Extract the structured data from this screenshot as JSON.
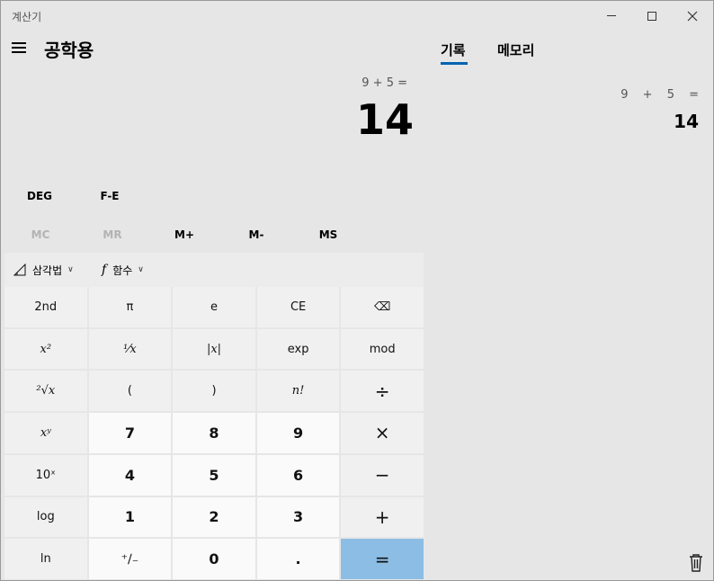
{
  "window": {
    "title": "계산기"
  },
  "header": {
    "mode_title": "공학용"
  },
  "display": {
    "expression": "9 + 5 =",
    "result": "14"
  },
  "angle_row": {
    "deg": "DEG",
    "fe": "F-E"
  },
  "memory_row": {
    "mc": "MC",
    "mr": "MR",
    "mplus": "M+",
    "mminus": "M-",
    "ms": "MS"
  },
  "func_strip": {
    "trig": "삼각법",
    "func": "함수",
    "func_icon_glyph": "f"
  },
  "keypad": [
    {
      "name": "second-key",
      "label": "2nd"
    },
    {
      "name": "pi-key",
      "label": "π"
    },
    {
      "name": "e-key",
      "label": "e"
    },
    {
      "name": "ce-key",
      "label": "CE"
    },
    {
      "name": "backspace-key",
      "label": "⌫"
    },
    {
      "name": "square-key",
      "label": "x²"
    },
    {
      "name": "reciprocal-key",
      "label": "¹⁄x"
    },
    {
      "name": "abs-key",
      "label": "|x|"
    },
    {
      "name": "exp-key",
      "label": "exp"
    },
    {
      "name": "mod-key",
      "label": "mod"
    },
    {
      "name": "sqrt-key",
      "label": "²√x"
    },
    {
      "name": "open-paren-key",
      "label": "("
    },
    {
      "name": "close-paren-key",
      "label": ")"
    },
    {
      "name": "factorial-key",
      "label": "n!"
    },
    {
      "name": "divide-key",
      "label": "÷"
    },
    {
      "name": "power-key",
      "label": "xʸ"
    },
    {
      "name": "seven-key",
      "label": "7"
    },
    {
      "name": "eight-key",
      "label": "8"
    },
    {
      "name": "nine-key",
      "label": "9"
    },
    {
      "name": "multiply-key",
      "label": "×"
    },
    {
      "name": "ten-power-key",
      "label": "10ˣ"
    },
    {
      "name": "four-key",
      "label": "4"
    },
    {
      "name": "five-key",
      "label": "5"
    },
    {
      "name": "six-key",
      "label": "6"
    },
    {
      "name": "minus-key",
      "label": "−"
    },
    {
      "name": "log-key",
      "label": "log"
    },
    {
      "name": "one-key",
      "label": "1"
    },
    {
      "name": "two-key",
      "label": "2"
    },
    {
      "name": "three-key",
      "label": "3"
    },
    {
      "name": "plus-key",
      "label": "+"
    },
    {
      "name": "ln-key",
      "label": "ln"
    },
    {
      "name": "negate-key",
      "label": "⁺∕₋"
    },
    {
      "name": "zero-key",
      "label": "0"
    },
    {
      "name": "decimal-key",
      "label": "."
    },
    {
      "name": "equals-key",
      "label": "="
    }
  ],
  "side_panel": {
    "tabs": {
      "history": "기록",
      "memory": "메모리"
    },
    "history": [
      {
        "expression": "9 + 5 =",
        "result": "14"
      }
    ]
  },
  "colors": {
    "accent": "#0063b1",
    "equals": "#8cbde4"
  },
  "icons": {
    "min": "minimize-icon",
    "max": "maximize-icon",
    "close": "close-icon",
    "menu": "hamburger-icon",
    "trig": "triangle-ruler-icon",
    "func": "function-icon",
    "trash": "trash-icon"
  }
}
